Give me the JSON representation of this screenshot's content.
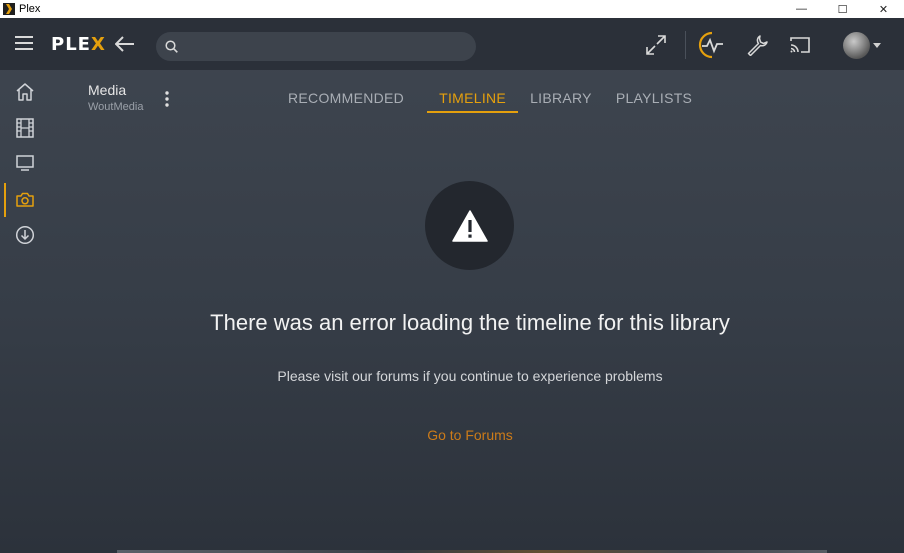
{
  "window": {
    "title": "Plex",
    "minimize_glyph": "—",
    "maximize_glyph": "☐",
    "close_glyph": "✕"
  },
  "topbar": {
    "logo_main": "PLE",
    "logo_accent": "X",
    "search_placeholder": "",
    "search_value": "",
    "icons": [
      "menu-icon",
      "back-icon",
      "search-icon",
      "fullscreen-icon",
      "activity-icon",
      "settings-wrench-icon",
      "cast-icon",
      "avatar"
    ]
  },
  "sidebar": {
    "items": [
      {
        "icon": "home-icon",
        "active": false
      },
      {
        "icon": "film-icon",
        "active": false
      },
      {
        "icon": "tv-icon",
        "active": false
      },
      {
        "icon": "camera-icon",
        "active": true
      },
      {
        "icon": "download-icon",
        "active": false
      }
    ]
  },
  "library": {
    "title": "Media",
    "server": "WoutMedia"
  },
  "tabs": [
    {
      "label": "RECOMMENDED",
      "active": false
    },
    {
      "label": "TIMELINE",
      "active": true
    },
    {
      "label": "LIBRARY",
      "active": false
    },
    {
      "label": "PLAYLISTS",
      "active": false
    }
  ],
  "error": {
    "icon": "warning-icon",
    "title": "There was an error loading the timeline for this library",
    "message": "Please visit our forums if you continue to experience problems",
    "link_label": "Go to Forums"
  },
  "colors": {
    "accent": "#e5a00d",
    "link": "#cc7b19",
    "topbar_bg": "#2b3039",
    "background": "#3a414c"
  }
}
